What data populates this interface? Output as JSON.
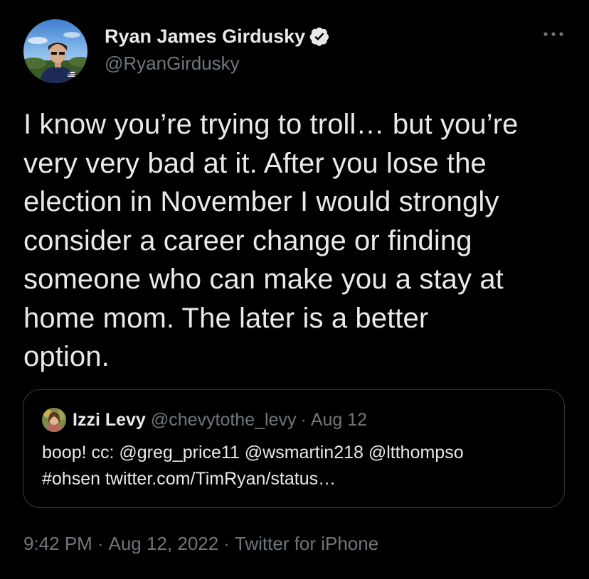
{
  "author": {
    "name": "Ryan James Girdusky",
    "handle": "@RyanGirdusky",
    "verified": true,
    "avatar_icon": "profile-photo"
  },
  "more_icon": "more-horizontal-icon",
  "tweet": {
    "text": "I know you’re trying to troll… but you’re\nvery very bad at it. After you lose the\nelection in November I would strongly\nconsider a career change or finding\nsomeone who can make you a stay at\nhome mom. The later is a better\noption."
  },
  "quote": {
    "name": "Izzi Levy",
    "handle": "@chevytothe_levy",
    "separator": "·",
    "date": "Aug 12",
    "text_line1": "boop! cc: @greg_price11 @wsmartin218 @ltthompso",
    "text_line2": "#ohsen twitter.com/TimRyan/status…"
  },
  "meta": {
    "time": "9:42 PM",
    "separator": "·",
    "date": "Aug 12, 2022",
    "source": "Twitter for iPhone"
  },
  "colors": {
    "background": "#000000",
    "text_primary": "#e7e9ea",
    "text_secondary": "#71767b",
    "border": "#333639",
    "verified_badge": "#e7e9ea"
  }
}
